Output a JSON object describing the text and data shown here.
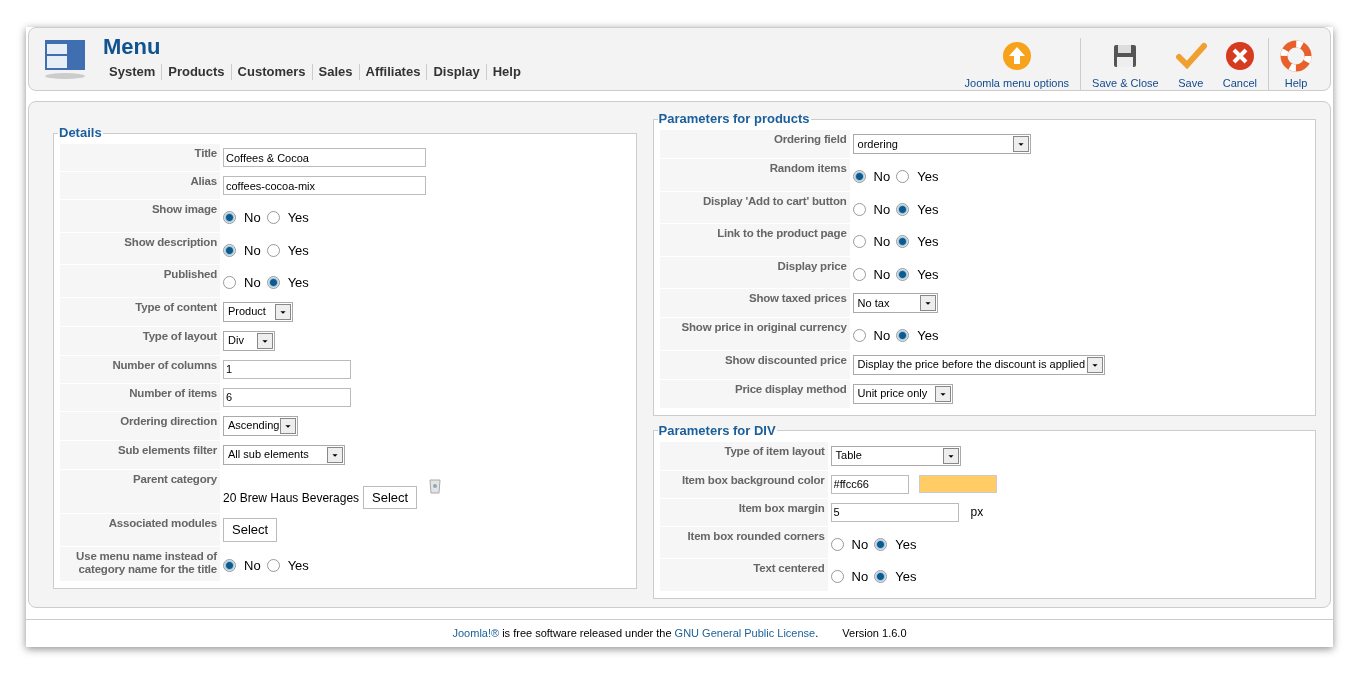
{
  "header": {
    "title": "Menu",
    "nav": [
      {
        "label": "System"
      },
      {
        "label": "Products"
      },
      {
        "label": "Customers"
      },
      {
        "label": "Sales"
      },
      {
        "label": "Affiliates"
      },
      {
        "label": "Display"
      },
      {
        "label": "Help"
      }
    ],
    "toolbar": [
      {
        "kind": "upload",
        "label": "Joomla menu options"
      },
      {
        "kind": "disk",
        "label": "Save & Close"
      },
      {
        "kind": "check",
        "label": "Save"
      },
      {
        "kind": "cancel",
        "label": "Cancel"
      },
      {
        "kind": "help",
        "label": "Help"
      }
    ]
  },
  "details": {
    "legend": "Details",
    "fields": [
      {
        "kind": "text",
        "label": "Title",
        "value": "Coffees & Cocoa"
      },
      {
        "kind": "text",
        "label": "Alias",
        "value": "coffees-cocoa-mix"
      },
      {
        "kind": "radio",
        "label": "Show image",
        "options": [
          {
            "label": "No",
            "selected": true
          },
          {
            "label": "Yes",
            "selected": false
          }
        ]
      },
      {
        "kind": "radio",
        "label": "Show description",
        "options": [
          {
            "label": "No",
            "selected": true
          },
          {
            "label": "Yes",
            "selected": false
          }
        ]
      },
      {
        "kind": "radio",
        "label": "Published",
        "options": [
          {
            "label": "No",
            "selected": false
          },
          {
            "label": "Yes",
            "selected": true
          }
        ]
      },
      {
        "kind": "select",
        "label": "Type of content",
        "value": "Product"
      },
      {
        "kind": "select",
        "label": "Type of layout",
        "value": "Div"
      },
      {
        "kind": "number",
        "label": "Number of columns",
        "value": "1"
      },
      {
        "kind": "number",
        "label": "Number of items",
        "value": "6"
      },
      {
        "kind": "select",
        "label": "Ordering direction",
        "value": "Ascending"
      },
      {
        "kind": "select",
        "label": "Sub elements filter",
        "value": "All sub elements"
      },
      {
        "kind": "category",
        "label": "Parent category",
        "value": "20 Brew Haus Beverages",
        "button": "Select"
      },
      {
        "kind": "button",
        "label": "Associated modules",
        "button": "Select"
      },
      {
        "kind": "radio",
        "label": "Use menu name instead of category name for the title",
        "options": [
          {
            "label": "No",
            "selected": true
          },
          {
            "label": "Yes",
            "selected": false
          }
        ]
      }
    ]
  },
  "products": {
    "legend": "Parameters for products",
    "fields": [
      {
        "kind": "select",
        "label": "Ordering field",
        "value": "ordering"
      },
      {
        "kind": "radio",
        "label": "Random items",
        "options": [
          {
            "label": "No",
            "selected": true
          },
          {
            "label": "Yes",
            "selected": false
          }
        ]
      },
      {
        "kind": "radio",
        "label": "Display 'Add to cart' button",
        "options": [
          {
            "label": "No",
            "selected": false
          },
          {
            "label": "Yes",
            "selected": true
          }
        ]
      },
      {
        "kind": "radio",
        "label": "Link to the product page",
        "options": [
          {
            "label": "No",
            "selected": false
          },
          {
            "label": "Yes",
            "selected": true
          }
        ]
      },
      {
        "kind": "radio",
        "label": "Display price",
        "options": [
          {
            "label": "No",
            "selected": false
          },
          {
            "label": "Yes",
            "selected": true
          }
        ]
      },
      {
        "kind": "select",
        "label": "Show taxed prices",
        "value": "No tax"
      },
      {
        "kind": "radio",
        "label": "Show price in original currency",
        "options": [
          {
            "label": "No",
            "selected": false
          },
          {
            "label": "Yes",
            "selected": true
          }
        ]
      },
      {
        "kind": "select",
        "label": "Show discounted price",
        "value": "Display the price before the discount is applied"
      },
      {
        "kind": "select",
        "label": "Price display method",
        "value": "Unit price only"
      }
    ]
  },
  "div": {
    "legend": "Parameters for DIV",
    "fields": [
      {
        "kind": "select",
        "label": "Type of item layout",
        "value": "Table"
      },
      {
        "kind": "color",
        "label": "Item box background color",
        "value": "#ffcc66",
        "color": "#ffcc66"
      },
      {
        "kind": "unit",
        "label": "Item box margin",
        "value": "5",
        "unit": "px"
      },
      {
        "kind": "radio",
        "label": "Item box rounded corners",
        "options": [
          {
            "label": "No",
            "selected": false
          },
          {
            "label": "Yes",
            "selected": true
          }
        ]
      },
      {
        "kind": "radio",
        "label": "Text centered",
        "options": [
          {
            "label": "No",
            "selected": false
          },
          {
            "label": "Yes",
            "selected": true
          }
        ]
      }
    ]
  },
  "footer": {
    "parts": [
      {
        "kind": "link",
        "text": "Joomla!®"
      },
      {
        "kind": "text",
        "text": " is free software released under the "
      },
      {
        "kind": "link",
        "text": "GNU General Public License"
      },
      {
        "kind": "text",
        "text": "."
      }
    ],
    "version": "Version 1.6.0"
  }
}
